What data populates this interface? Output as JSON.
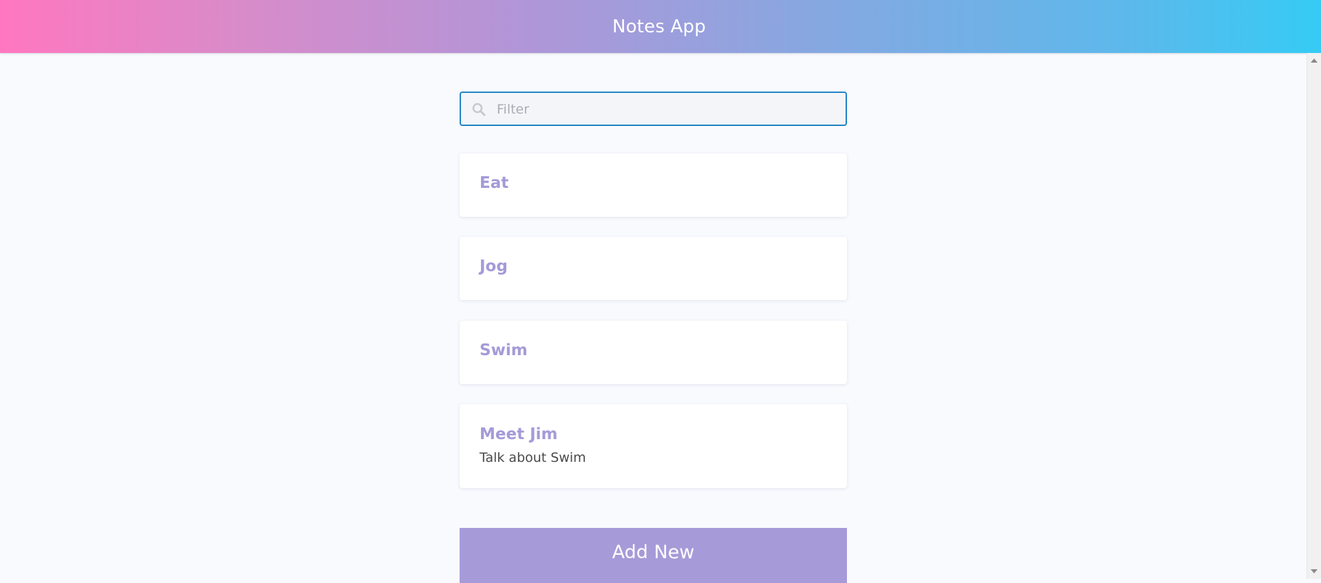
{
  "header": {
    "title": "Notes App"
  },
  "filter": {
    "placeholder": "Filter",
    "value": "",
    "icon": "search-icon"
  },
  "notes": [
    {
      "title": "Eat",
      "body": ""
    },
    {
      "title": "Jog",
      "body": ""
    },
    {
      "title": "Swim",
      "body": ""
    },
    {
      "title": "Meet Jim",
      "body": "Talk about Swim"
    }
  ],
  "actions": {
    "add_label": "Add New"
  },
  "colors": {
    "accent": "#a69bd8",
    "focus_border": "#1f83c5",
    "gradient_start": "#ff77c0",
    "gradient_end": "#35cbf4"
  }
}
